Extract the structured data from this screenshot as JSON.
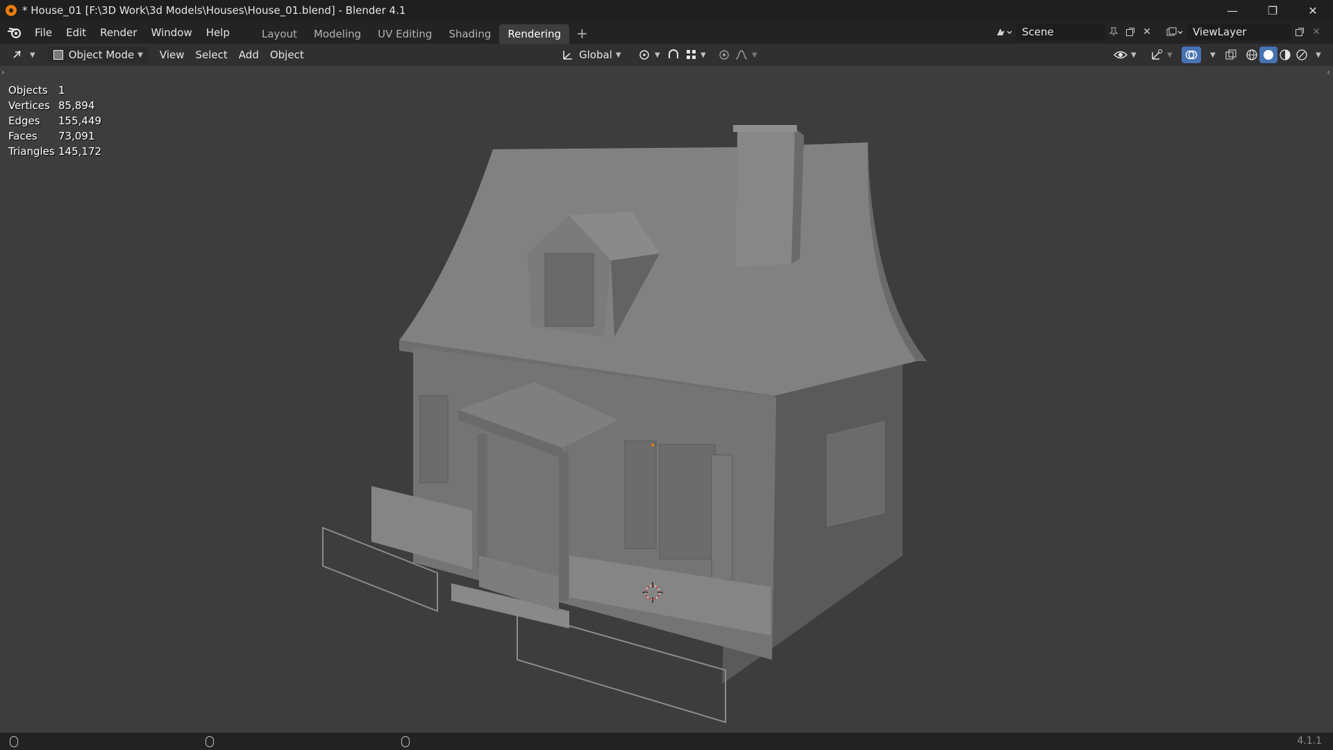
{
  "window": {
    "title": "* House_01 [F:\\3D Work\\3d Models\\Houses\\House_01.blend] - Blender 4.1",
    "minimize": "—",
    "maximize": "❐",
    "close": "✕"
  },
  "menu": [
    "File",
    "Edit",
    "Render",
    "Window",
    "Help"
  ],
  "workspaces": [
    "Layout",
    "Modeling",
    "UV Editing",
    "Shading",
    "Rendering"
  ],
  "active_workspace": "Rendering",
  "add_workspace": "+",
  "scene": {
    "name": "Scene"
  },
  "view_layer": {
    "name": "ViewLayer"
  },
  "viewport_header": {
    "mode": "Object Mode",
    "menus": [
      "View",
      "Select",
      "Add",
      "Object"
    ],
    "transform_orientation": "Global"
  },
  "stats": [
    {
      "label": "Objects",
      "value": "1"
    },
    {
      "label": "Vertices",
      "value": "85,894"
    },
    {
      "label": "Edges",
      "value": "155,449"
    },
    {
      "label": "Faces",
      "value": "73,091"
    },
    {
      "label": "Triangles",
      "value": "145,172"
    }
  ],
  "status": {
    "version": "4.1.1"
  },
  "colors": {
    "accent": "#4772b3",
    "viewport_bg": "#3d3d3d",
    "header_bg": "#303030",
    "topbar_bg": "#232323"
  },
  "icons": [
    "blender-logo-icon",
    "editor-type-icon",
    "object-mode-icon",
    "transform-orientation-icon",
    "pivot-icon",
    "snap-icon",
    "proportional-edit-icon",
    "visibility-icon",
    "gizmo-icon",
    "overlay-icon",
    "xray-icon",
    "wireframe-shading-icon",
    "solid-shading-icon",
    "material-shading-icon",
    "rendered-shading-icon",
    "pin-icon",
    "new-scene-icon",
    "delete-icon",
    "mouse-icon"
  ]
}
